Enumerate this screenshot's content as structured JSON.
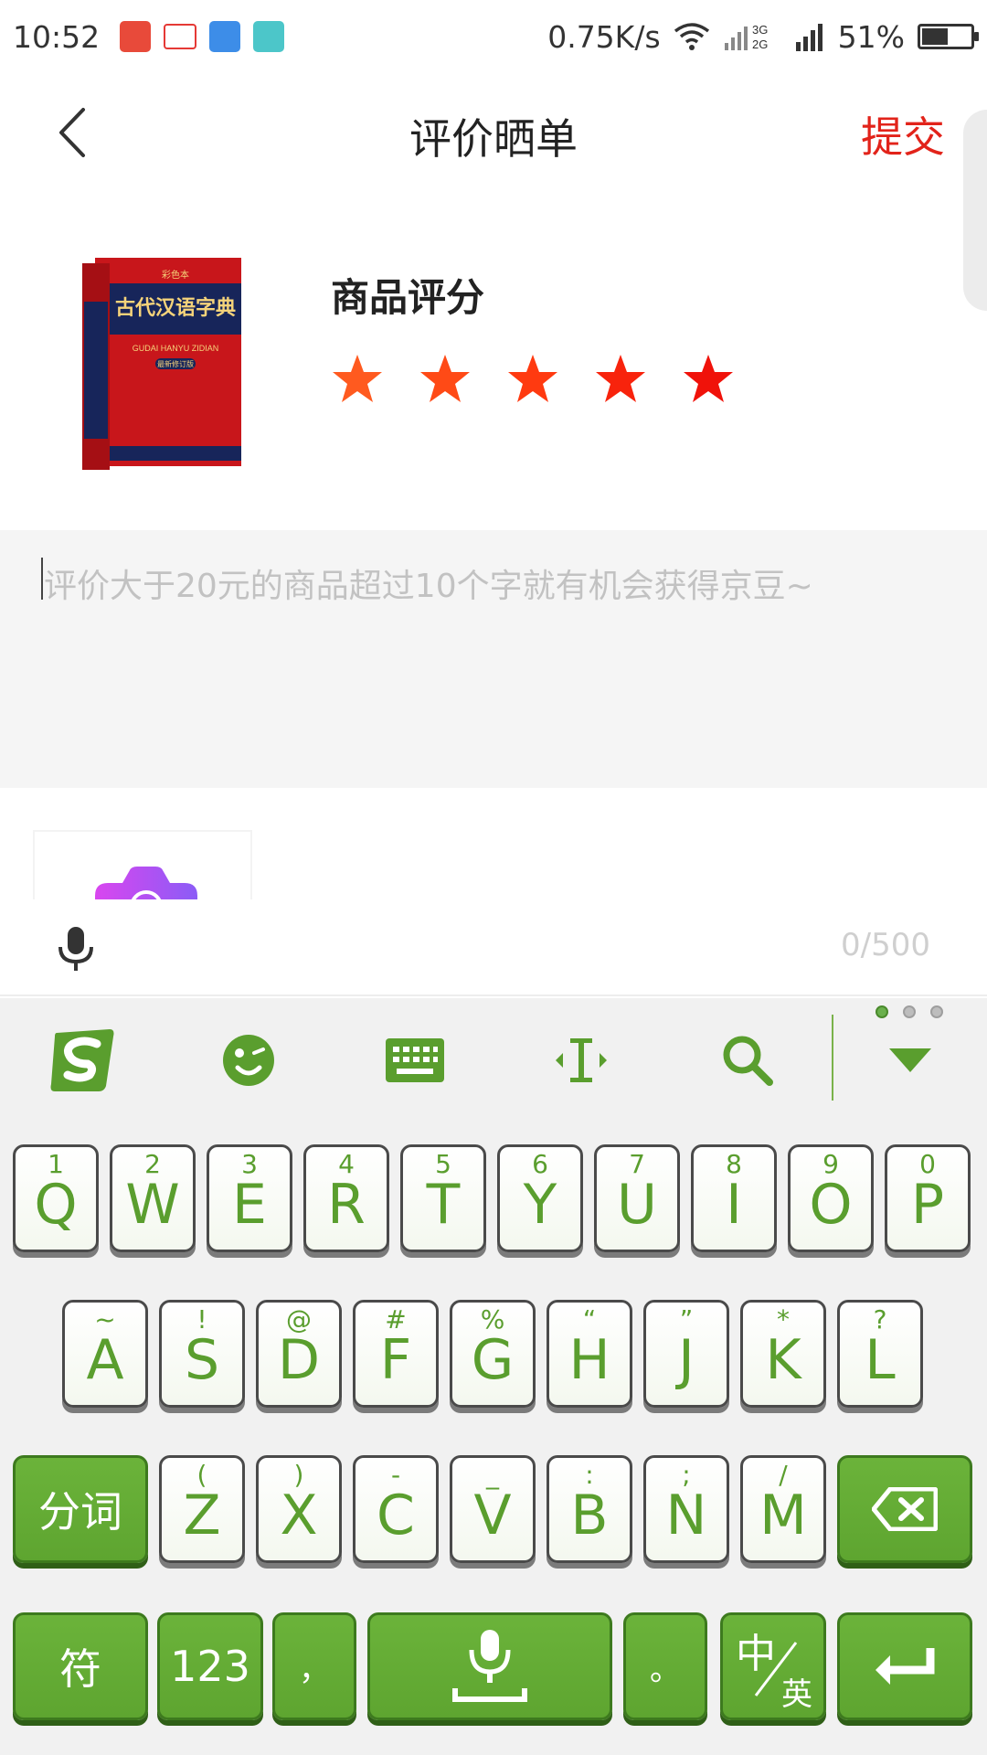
{
  "status_bar": {
    "time": "10:52",
    "network_speed": "0.75K/s",
    "net_3g": "3G",
    "net_2g": "2G",
    "battery": "51%"
  },
  "header": {
    "title": "评价晒单",
    "submit": "提交"
  },
  "product": {
    "rating_title": "商品评分",
    "rating": 5,
    "rating_max": 5,
    "book_series": "彩色本",
    "book_title_cn": "古代汉语字典",
    "book_title_pinyin": "GUDAI HANYU ZIDIAN",
    "book_edition": "最新修订版"
  },
  "comment": {
    "placeholder": "评价大于20元的商品超过10个字就有机会获得京豆~",
    "char_count": "0/500"
  },
  "keyboard": {
    "row1": [
      {
        "main": "Q",
        "sub": "1"
      },
      {
        "main": "W",
        "sub": "2"
      },
      {
        "main": "E",
        "sub": "3"
      },
      {
        "main": "R",
        "sub": "4"
      },
      {
        "main": "T",
        "sub": "5"
      },
      {
        "main": "Y",
        "sub": "6"
      },
      {
        "main": "U",
        "sub": "7"
      },
      {
        "main": "I",
        "sub": "8"
      },
      {
        "main": "O",
        "sub": "9"
      },
      {
        "main": "P",
        "sub": "0"
      }
    ],
    "row2": [
      {
        "main": "A",
        "sub": "~"
      },
      {
        "main": "S",
        "sub": "!"
      },
      {
        "main": "D",
        "sub": "@"
      },
      {
        "main": "F",
        "sub": "#"
      },
      {
        "main": "G",
        "sub": "%"
      },
      {
        "main": "H",
        "sub": "“"
      },
      {
        "main": "J",
        "sub": "”"
      },
      {
        "main": "K",
        "sub": "*"
      },
      {
        "main": "L",
        "sub": "?"
      }
    ],
    "row3": [
      {
        "main": "Z",
        "sub": "("
      },
      {
        "main": "X",
        "sub": ")"
      },
      {
        "main": "C",
        "sub": "-"
      },
      {
        "main": "V",
        "sub": "_"
      },
      {
        "main": "B",
        "sub": ":"
      },
      {
        "main": "N",
        "sub": ";"
      },
      {
        "main": "M",
        "sub": "/"
      }
    ],
    "segment": "分词",
    "symbols": "符",
    "numbers": "123",
    "comma": "，",
    "period": "。",
    "lang_zh": "中",
    "lang_en": "英",
    "accent_color": "#6ab04c"
  }
}
